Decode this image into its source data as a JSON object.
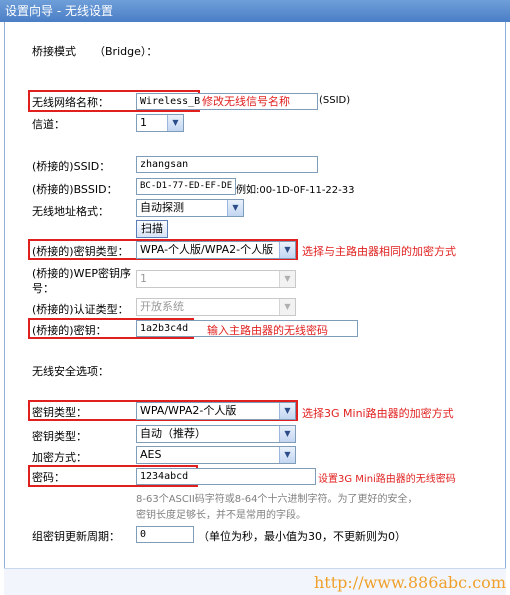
{
  "window": {
    "title": "设置向导 - 无线设置"
  },
  "mode": {
    "label": "桥接模式",
    "value": "（Bridge）："
  },
  "ssid": {
    "label": "无线网络名称：",
    "value": "Wireless_B",
    "note": "修改无线信号名称",
    "suffix": "(SSID)"
  },
  "channel": {
    "label": "信道：",
    "value": "1"
  },
  "bridged_ssid": {
    "label": "(桥接的)SSID：",
    "value": "zhangsan"
  },
  "bridged_bssid": {
    "label": "(桥接的)BSSID：",
    "value": "BC-D1-77-ED-EF-DE",
    "example": "例如:00-1D-0F-11-22-33"
  },
  "address_format": {
    "label": "无线地址格式：",
    "value": "自动探测"
  },
  "scan": {
    "label": "扫描"
  },
  "bridged_key_type": {
    "label": "(桥接的)密钥类型：",
    "value": "WPA-个人版/WPA2-个人版",
    "note": "选择与主路由器相同的加密方式"
  },
  "wep_index": {
    "label_line1": "(桥接的)WEP密钥序",
    "label_line2": "号：",
    "value": "1"
  },
  "auth_type": {
    "label": "(桥接的)认证类型：",
    "value": "开放系统"
  },
  "bridged_key": {
    "label": "(桥接的)密钥：",
    "value": "1a2b3c4d",
    "note": "输入主路由器的无线密码"
  },
  "security": {
    "heading": "无线安全选项："
  },
  "key_type": {
    "label": "密钥类型：",
    "value": "WPA/WPA2-个人版",
    "note": "选择3G Mini路由器的加密方式"
  },
  "key_type2": {
    "label": "密钥类型：",
    "value": "自动（推荐）"
  },
  "encryption": {
    "label": "加密方式：",
    "value": "AES"
  },
  "password": {
    "label": "密码：",
    "value": "1234abcd",
    "note": "设置3G Mini路由器的无线密码"
  },
  "hint": {
    "line1": "8-63个ASCII码字符或8-64个十六进制字符。为了更好的安全，",
    "line2": "密钥长度足够长，并不是常用的字段。"
  },
  "group_key": {
    "label": "组密钥更新周期：",
    "value": "0",
    "hint": "（单位为秒，最小值为30，不更新则为0）"
  },
  "watermark": "http://www.886abc.com"
}
